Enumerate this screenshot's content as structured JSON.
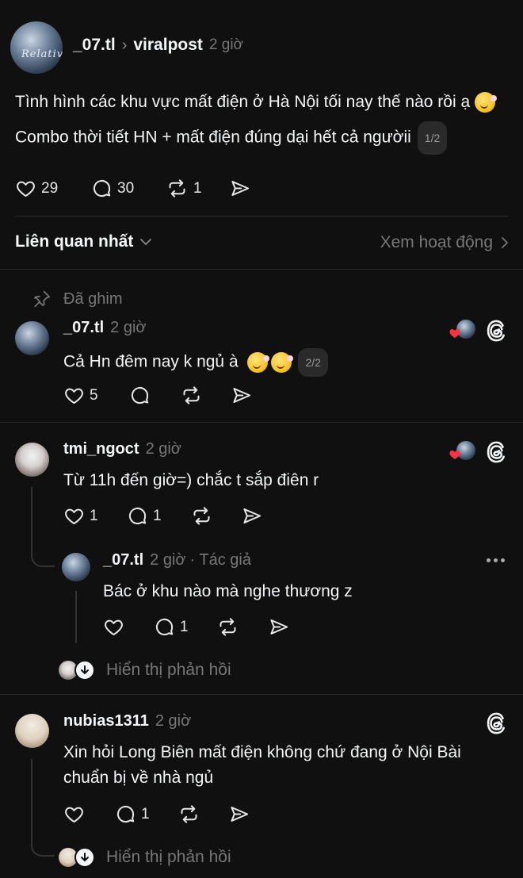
{
  "post": {
    "author": "_07.tl",
    "separator": "›",
    "community": "viralpost",
    "time": "2 giờ",
    "avatar_label": "Relative",
    "line1": "Tình hình các khu vực mất điện ở Hà Nội tối nay thế nào rồi ạ",
    "line2": "Combo thời tiết HN + mất điện đúng dại hết cả ngườii",
    "page_badge": "1/2",
    "likes": "29",
    "replies": "30",
    "reposts": "1"
  },
  "sort": {
    "label": "Liên quan nhất",
    "activity_link": "Xem hoạt động"
  },
  "pinned": {
    "label": "Đã ghim",
    "author": "_07.tl",
    "time": "2 giờ",
    "text": "Cả Hn đêm nay k ngủ à",
    "page_badge": "2/2",
    "likes": "5"
  },
  "comment1": {
    "author": "tmi_ngoct",
    "time": "2 giờ",
    "text": "Từ 11h đến giờ=) chắc t sắp điên r",
    "likes": "1",
    "replies": "1",
    "reply": {
      "author": "_07.tl",
      "time": "2 giờ",
      "author_tag": "· Tác giả",
      "text": "Bác ở khu nào mà nghe thương z",
      "replies": "1"
    },
    "show_replies": "Hiển thị phản hồi"
  },
  "comment2": {
    "author": "nubias1311",
    "time": "2 giờ",
    "text_line1": "Xin hỏi Long Biên mất điện không chứ đang ở Nội Bài",
    "text_line2": "chuẩn bị về nhà ngủ",
    "replies": "1",
    "show_replies": "Hiển thị phản hồi"
  },
  "colors": {
    "background": "#101010",
    "text": "#f3f5f7",
    "muted": "#777777",
    "heart_red": "#ff3040"
  }
}
